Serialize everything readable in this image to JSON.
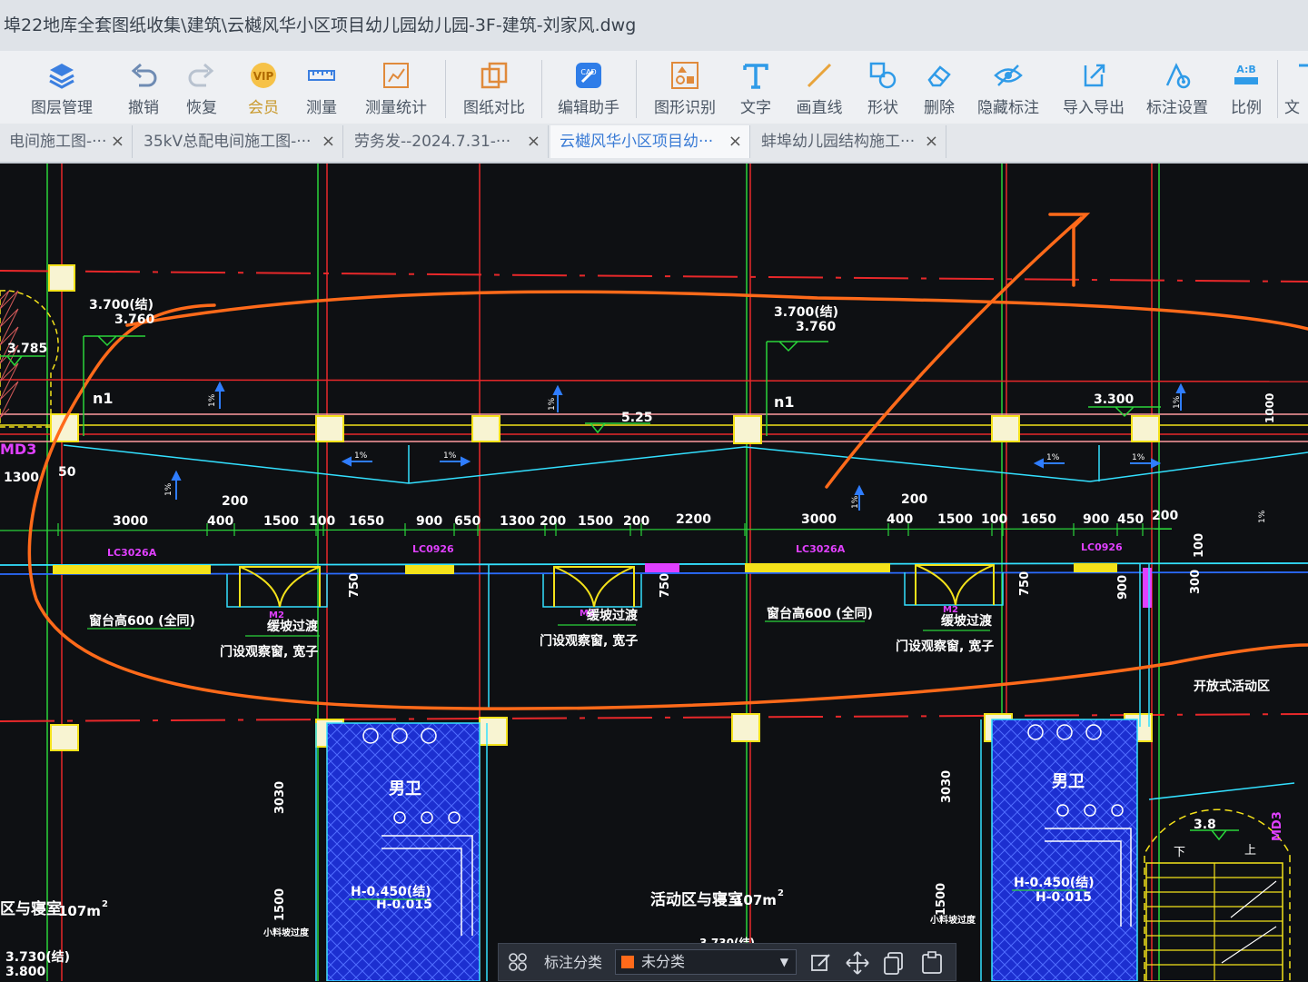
{
  "window": {
    "title": "埠22地库全套图纸收集\\建筑\\云樾风华小区项目幼儿园幼儿园-3F-建筑-刘家风.dwg"
  },
  "toolbar": {
    "items": [
      {
        "label": "图层管理",
        "icon": "layers-icon"
      },
      {
        "label": "撤销",
        "icon": "undo-icon"
      },
      {
        "label": "恢复",
        "icon": "redo-icon"
      },
      {
        "label": "会员",
        "icon": "vip-icon"
      },
      {
        "label": "测量",
        "icon": "ruler-icon"
      },
      {
        "label": "测量统计",
        "icon": "measure-stats-icon"
      },
      {
        "label": "图纸对比",
        "icon": "compare-icon"
      },
      {
        "label": "编辑助手",
        "icon": "cad-edit-icon"
      },
      {
        "label": "图形识别",
        "icon": "shape-recognize-icon"
      },
      {
        "label": "文字",
        "icon": "text-icon"
      },
      {
        "label": "画直线",
        "icon": "line-icon"
      },
      {
        "label": "形状",
        "icon": "shape-icon"
      },
      {
        "label": "删除",
        "icon": "eraser-icon"
      },
      {
        "label": "隐藏标注",
        "icon": "eye-off-icon"
      },
      {
        "label": "导入导出",
        "icon": "import-export-icon"
      },
      {
        "label": "标注设置",
        "icon": "annotation-settings-icon"
      },
      {
        "label": "比例",
        "icon": "scale-icon"
      },
      {
        "label": "文",
        "icon": "text2-icon"
      }
    ]
  },
  "tabs": [
    {
      "label": "电间施工图-···"
    },
    {
      "label": "35kV总配电间施工图-···"
    },
    {
      "label": "劳务发--2024.7.31-···"
    },
    {
      "label": "云樾风华小区项目幼···"
    },
    {
      "label": "蚌埠幼儿园结构施工···"
    }
  ],
  "tab_close": "×",
  "drawing": {
    "elevations": [
      "3.700(结)",
      "3.760",
      "3.785",
      "3.700(结)",
      "3.760",
      "3.300",
      "5.25",
      "3.8",
      "3.730(结)",
      "3.800"
    ],
    "marks": [
      "n1",
      "n1",
      "MD3",
      "MD3",
      "1300",
      "50",
      "1000"
    ],
    "dims_left": [
      "3000",
      "400",
      "200",
      "1500",
      "100",
      "1650",
      "900",
      "650",
      "1300",
      "200",
      "1500",
      "200",
      "2200"
    ],
    "dims_right": [
      "3000",
      "400",
      "200",
      "1500",
      "100",
      "1650",
      "900",
      "450",
      "200"
    ],
    "window_tags": [
      "LC3026A",
      "LC0926",
      "LC3026A",
      "LC0926"
    ],
    "door_tags": [
      "M2",
      "M2",
      "M2"
    ],
    "notes": [
      "窗台高600 (全同)",
      "窗台高600 (全同)",
      "缓坡过渡",
      "门设观察窗, 宽子",
      "缓坡过渡",
      "门设观察窗, 宽子",
      "缓坡过渡",
      "门设观察窗, 宽子",
      "开放式活动区",
      "男卫",
      "男卫",
      "H-0.450(结)",
      "H-0.015",
      "H-0.450(结)",
      "H-0.015",
      "活动区与寝室",
      "107m",
      "2",
      "区与寝室",
      "107m",
      "2",
      "小料坡过度",
      "小料坡过度",
      "3.730(结)"
    ],
    "vert_dims": [
      "750",
      "750",
      "750",
      "900",
      "300",
      "100",
      "3030",
      "3030",
      "1500",
      "1500"
    ],
    "slopes": [
      "1%",
      "1%",
      "1%",
      "1%",
      "1%",
      "1%",
      "1%",
      "1%",
      "1%",
      "1%"
    ],
    "stair": [
      "下",
      "上"
    ]
  },
  "statusbar": {
    "label": "标注分类",
    "select_value": "未分类"
  },
  "colors": {
    "canvas_bg": "#0e1013",
    "axis_red": "#e8282a",
    "axis_green": "#2ad43a",
    "wall_cyan": "#33e0ff",
    "wall_blue": "#2b6cff",
    "yellow": "#f4e21a",
    "annotation_orange": "#ff6a1a",
    "magenta": "#e040ff",
    "hatch_blue": "#1c2fd0"
  }
}
